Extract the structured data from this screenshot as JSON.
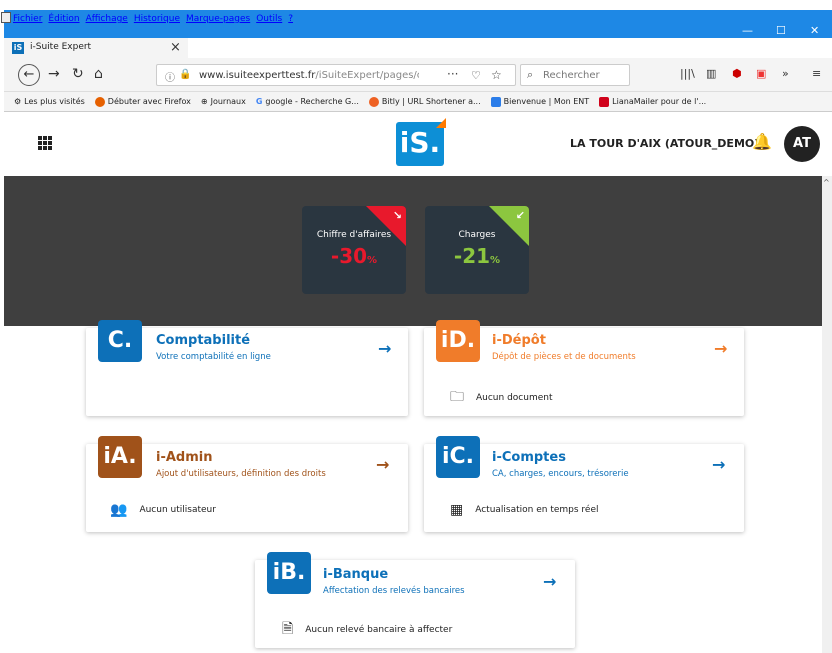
{
  "browser": {
    "menu": [
      "Fichier",
      "Édition",
      "Affichage",
      "Historique",
      "Marque-pages",
      "Outils",
      "?"
    ],
    "tab_title": "i-Suite Expert",
    "url_host": "www.isuiteexperttest.fr",
    "url_path": "/iSuiteExpert/pages/c",
    "search_placeholder": "Rechercher",
    "bookmarks": [
      {
        "label": "Les plus visités",
        "color": "#555"
      },
      {
        "label": "Débuter avec Firefox",
        "color": "#e66000"
      },
      {
        "label": "Journaux",
        "color": "#333"
      },
      {
        "label": "google - Recherche G...",
        "color": "#4285f4"
      },
      {
        "label": "Bitly | URL Shortener a...",
        "color": "#ee6123"
      },
      {
        "label": "Bienvenue | Mon ENT",
        "color": "#2b7de9"
      },
      {
        "label": "LianaMailer pour de l'...",
        "color": "#d0021b"
      }
    ]
  },
  "header": {
    "logo": "iS.",
    "company": "LA TOUR D'AIX (ATOUR_DEMO)",
    "avatar": "AT"
  },
  "kpis": [
    {
      "title": "Chiffre d'affaires",
      "value": "-30",
      "unit": "%",
      "color": "#e8192c",
      "arrow": "↘"
    },
    {
      "title": "Charges",
      "value": "-21",
      "unit": "%",
      "color": "#8cc63f",
      "arrow": "↙"
    }
  ],
  "cards": {
    "compta": {
      "badge": "C.",
      "title": "Comptabilité",
      "subtitle": "Votre comptabilité en ligne",
      "color": "#0d70b8"
    },
    "depot": {
      "badge": "iD.",
      "title": "i-Dépôt",
      "subtitle": "Dépôt de pièces et de documents",
      "color": "#f07c2a",
      "info": "Aucun document"
    },
    "admin": {
      "badge": "iA.",
      "title": "i-Admin",
      "subtitle": "Ajout d'utilisateurs, définition des droits",
      "color": "#a0521a",
      "info": "Aucun utilisateur"
    },
    "comptes": {
      "badge": "iC.",
      "title": "i-Comptes",
      "subtitle": "CA, charges, encours, trésorerie",
      "color": "#0d70b8",
      "info": "Actualisation en temps réel"
    },
    "banque": {
      "badge": "iB.",
      "title": "i-Banque",
      "subtitle": "Affectation des relevés bancaires",
      "color": "#0d70b8",
      "info": "Aucun relevé bancaire à affecter"
    }
  }
}
